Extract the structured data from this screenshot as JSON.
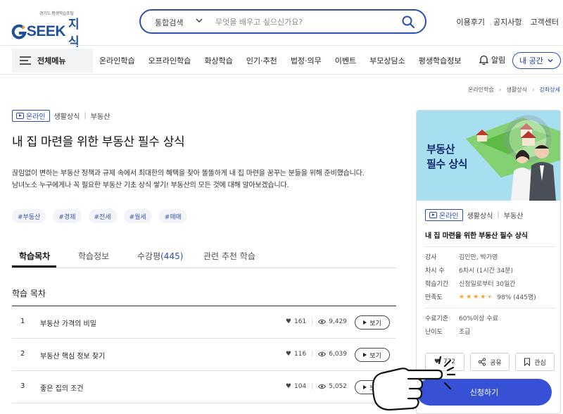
{
  "header": {
    "logo_sub": "경기도 평생학습포털",
    "logo_main": "SEEK",
    "logo_ko": "지식",
    "search": {
      "category": "통합검색",
      "placeholder": "무엇을 배우고 싶으신가요?"
    },
    "links": [
      "이용후기",
      "공지사항",
      "고객센터"
    ]
  },
  "nav": {
    "all_menu": "전체메뉴",
    "items": [
      "온라인학습",
      "오프라인학습",
      "화상학습",
      "인기·추천",
      "법정·의무",
      "이벤트",
      "부모상담소",
      "평생학습정보"
    ],
    "alarm": "알림",
    "my_space": "내 공간"
  },
  "breadcrumb": [
    "온라인학습",
    "생활상식",
    "강좌상세"
  ],
  "course": {
    "badge": "온라인",
    "category": "생활상식",
    "subcategory": "부동산",
    "title": "내 집 마련을 위한 부동산 필수 상식",
    "desc_line1": "끊임없이 변하는 부동산 정책과 규제 속에서 최대한의 혜택을 찾아 똘똘하게 내 집 마련을 꿈꾸는 분들을 위해 준비했습니다.",
    "desc_line2": "남녀노소 누구에게나 꼭 필요한 부동산 기초 상식 쌓기! 부동산의 모든 것에 대해 알아보겠습니다.",
    "tags": [
      "#부동산",
      "#경제",
      "#전세",
      "#월세",
      "#매매"
    ]
  },
  "tabs": {
    "toc": "학습목차",
    "info": "학습정보",
    "review": "수강평",
    "review_count": "(445)",
    "related": "관련 추천 학습"
  },
  "toc": {
    "title": "학습 목차",
    "view_label": "보기",
    "rows": [
      {
        "no": "1",
        "name": "부동산 가격의 비밀",
        "likes": "161",
        "views": "9,429"
      },
      {
        "no": "2",
        "name": "부동산 핵심 정보 찾기",
        "likes": "116",
        "views": "6,039"
      },
      {
        "no": "3",
        "name": "좋은 집의 조건",
        "likes": "104",
        "views": "5,052"
      }
    ]
  },
  "card": {
    "thumb_line1": "부동산",
    "thumb_line2": "필수 상식",
    "badge": "온라인",
    "category": "생활상식",
    "subcategory": "부동산",
    "title": "내 집 마련을 위한 부동산 필수 상식",
    "info": [
      {
        "label": "강사",
        "value": "김인만, 박가영"
      },
      {
        "label": "차시 수",
        "value": "6차시 (1시간 34분)"
      },
      {
        "label": "학습기간",
        "value": "신청일로부터 30일간"
      }
    ],
    "satisfaction_label": "만족도",
    "satisfaction_stars": 4.5,
    "satisfaction_value": "98% (445명)",
    "info2": [
      {
        "label": "수료기준",
        "value": "60%이상 수료"
      },
      {
        "label": "난이도",
        "value": "초급"
      }
    ],
    "like_count": "772",
    "share": "공유",
    "bookmark": "관심",
    "apply": "신청하기"
  },
  "colors": {
    "brand_blue": "#2d4db3",
    "apply_blue": "#3651d5",
    "star": "#f5a623"
  }
}
